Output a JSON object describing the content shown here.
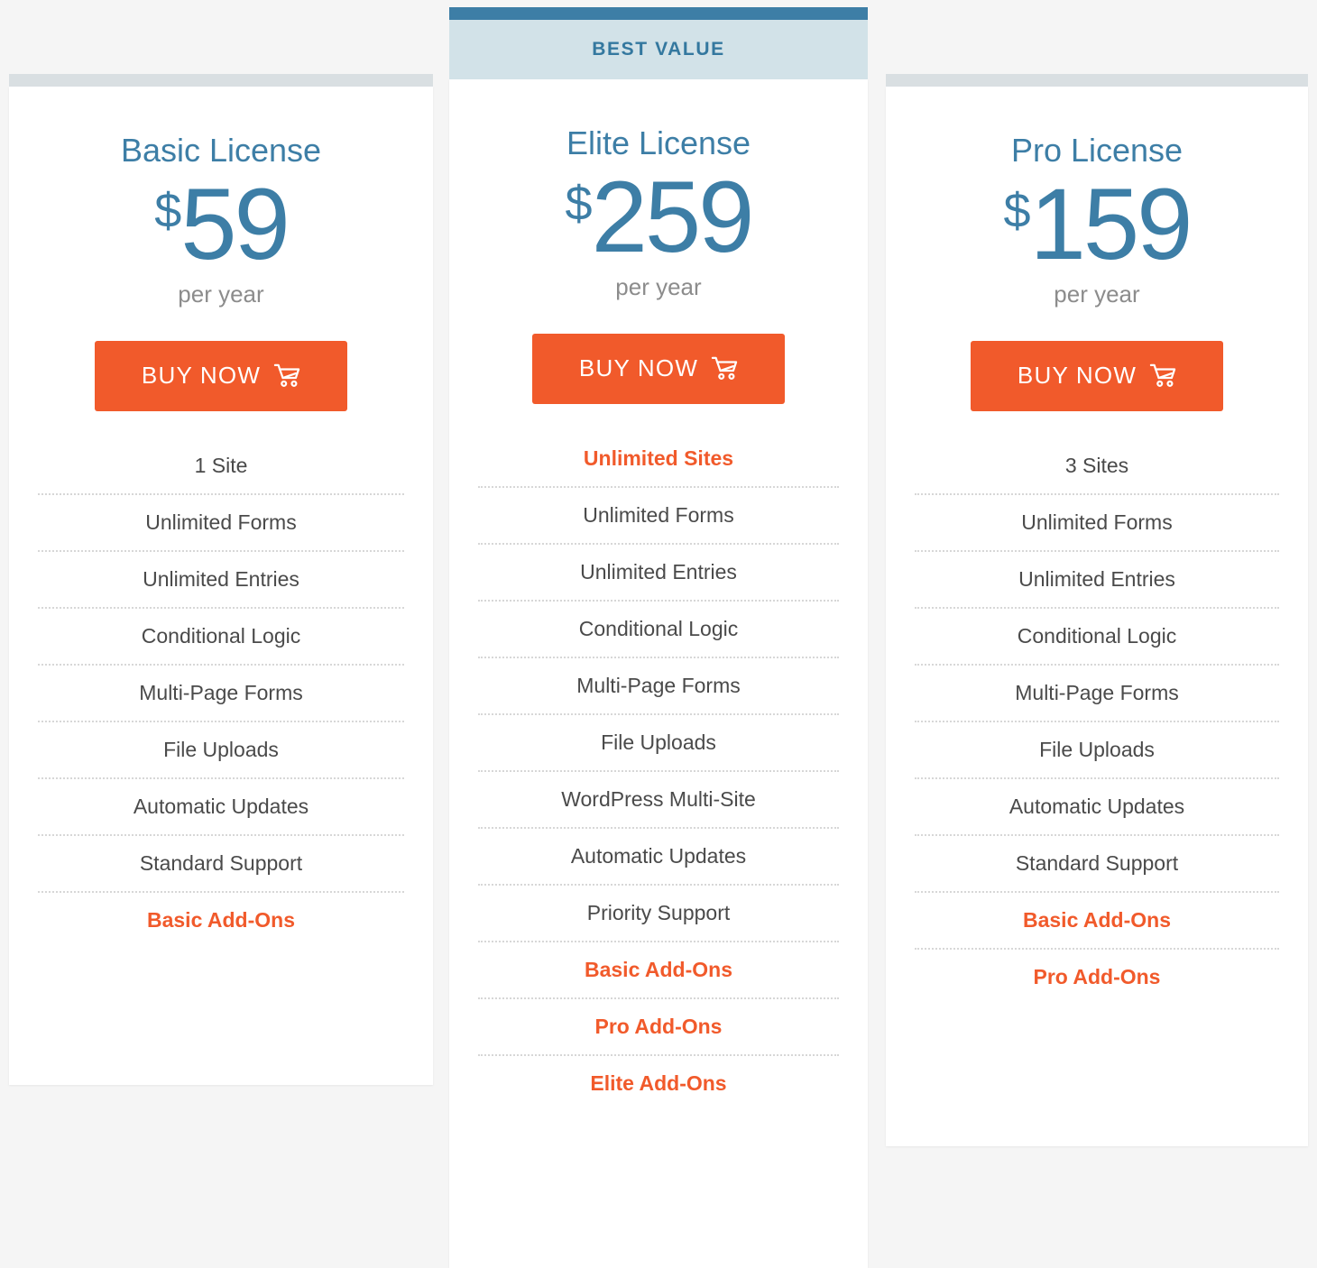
{
  "colors": {
    "accent_blue": "#3d7ea6",
    "badge_band": "#d2e2e8",
    "card_top_bar": "#d9dfe2",
    "cta_orange": "#f15a2b",
    "page_background": "#f5f5f5",
    "feature_text": "#4a4a4a",
    "period_text": "#8c8c8c"
  },
  "plans": [
    {
      "id": "basic",
      "name": "Basic License",
      "currency_symbol": "$",
      "price": "59",
      "period": "per year",
      "cta_label": "BUY NOW",
      "cta_icon": "shopping-cart-icon",
      "badge": null,
      "features": [
        {
          "label": "1 Site",
          "highlight": false
        },
        {
          "label": "Unlimited Forms",
          "highlight": false
        },
        {
          "label": "Unlimited Entries",
          "highlight": false
        },
        {
          "label": "Conditional Logic",
          "highlight": false
        },
        {
          "label": "Multi-Page Forms",
          "highlight": false
        },
        {
          "label": "File Uploads",
          "highlight": false
        },
        {
          "label": "Automatic Updates",
          "highlight": false
        },
        {
          "label": "Standard Support",
          "highlight": false
        },
        {
          "label": "Basic Add-Ons",
          "highlight": true
        }
      ]
    },
    {
      "id": "elite",
      "name": "Elite License",
      "currency_symbol": "$",
      "price": "259",
      "period": "per year",
      "cta_label": "BUY NOW",
      "cta_icon": "shopping-cart-icon",
      "badge": "BEST VALUE",
      "features": [
        {
          "label": "Unlimited Sites",
          "highlight": true
        },
        {
          "label": "Unlimited Forms",
          "highlight": false
        },
        {
          "label": "Unlimited Entries",
          "highlight": false
        },
        {
          "label": "Conditional Logic",
          "highlight": false
        },
        {
          "label": "Multi-Page Forms",
          "highlight": false
        },
        {
          "label": "File Uploads",
          "highlight": false
        },
        {
          "label": "WordPress Multi-Site",
          "highlight": false
        },
        {
          "label": "Automatic Updates",
          "highlight": false
        },
        {
          "label": "Priority Support",
          "highlight": false
        },
        {
          "label": "Basic Add-Ons",
          "highlight": true
        },
        {
          "label": "Pro Add-Ons",
          "highlight": true
        },
        {
          "label": "Elite Add-Ons",
          "highlight": true
        }
      ]
    },
    {
      "id": "pro",
      "name": "Pro License",
      "currency_symbol": "$",
      "price": "159",
      "period": "per year",
      "cta_label": "BUY NOW",
      "cta_icon": "shopping-cart-icon",
      "badge": null,
      "features": [
        {
          "label": "3 Sites",
          "highlight": false
        },
        {
          "label": "Unlimited Forms",
          "highlight": false
        },
        {
          "label": "Unlimited Entries",
          "highlight": false
        },
        {
          "label": "Conditional Logic",
          "highlight": false
        },
        {
          "label": "Multi-Page Forms",
          "highlight": false
        },
        {
          "label": "File Uploads",
          "highlight": false
        },
        {
          "label": "Automatic Updates",
          "highlight": false
        },
        {
          "label": "Standard Support",
          "highlight": false
        },
        {
          "label": "Basic Add-Ons",
          "highlight": true
        },
        {
          "label": "Pro Add-Ons",
          "highlight": true
        }
      ]
    }
  ]
}
